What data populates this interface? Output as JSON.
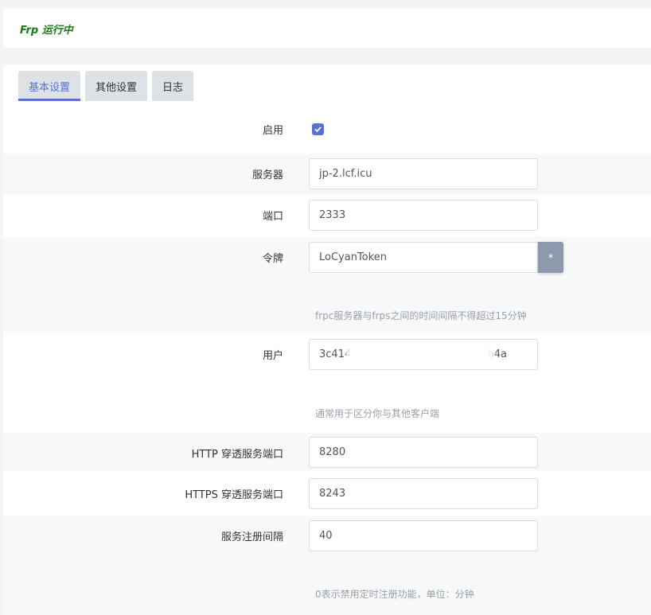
{
  "status": {
    "text": "Frp 运行中",
    "color": "#1a7a1a"
  },
  "tabs": [
    {
      "label": "基本设置",
      "active": true
    },
    {
      "label": "其他设置",
      "active": false
    },
    {
      "label": "日志",
      "active": false
    }
  ],
  "form": {
    "enable": {
      "label": "启用",
      "checked": true
    },
    "server": {
      "label": "服务器",
      "value": "jp-2.lcf.icu"
    },
    "port": {
      "label": "端口",
      "value": "2333"
    },
    "token": {
      "label": "令牌",
      "value": "LoCyanToken",
      "reveal_button": "*",
      "hint": "frpc服务器与frps之间的时间间隔不得超过15分钟"
    },
    "user": {
      "label": "用户",
      "value": "3c414",
      "value_tail": "b4a",
      "hint": "通常用于区分你与其他客户端"
    },
    "http_port": {
      "label": "HTTP 穿透服务端口",
      "value": "8280"
    },
    "https_port": {
      "label": "HTTPS 穿透服务端口",
      "value": "8243"
    },
    "register_interval": {
      "label": "服务注册间隔",
      "value": "40",
      "hint": "0表示禁用定时注册功能，单位：分钟"
    }
  },
  "colors": {
    "accent": "#5b6fd6",
    "tab_bg": "#dde2e7",
    "button": "#8d99ad"
  }
}
